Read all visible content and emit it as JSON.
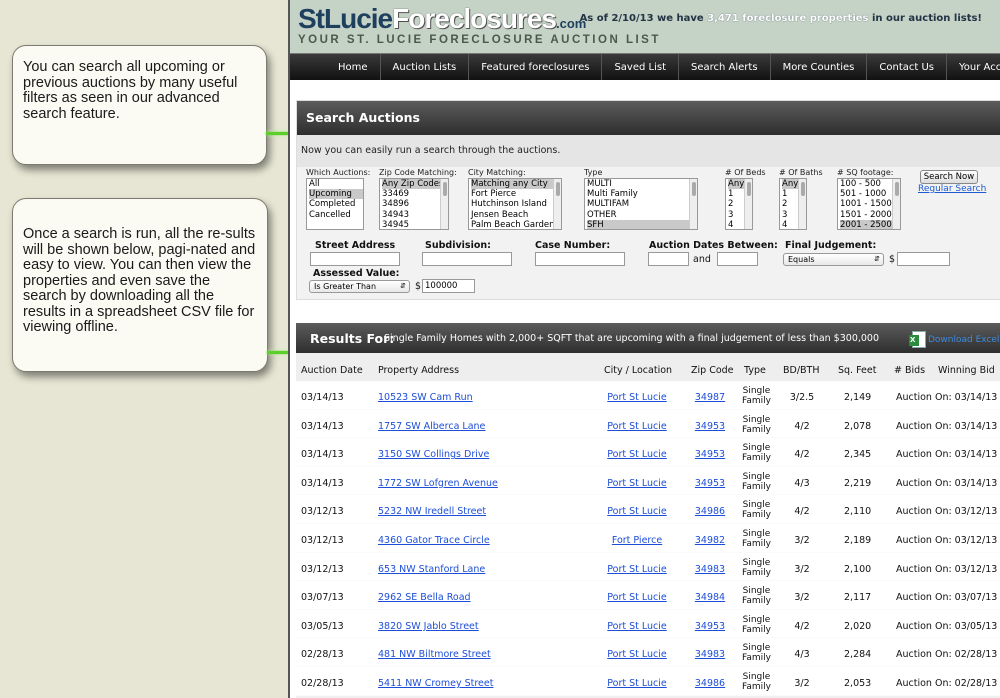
{
  "callouts": [
    {
      "text": "You can search all upcoming or previous auctions by many useful filters as seen in our advanced search feature."
    },
    {
      "text": "Once a search is run, all the re-sults will be shown below, pagi-nated and easy to view.  You can then view the properties and even save the search by downloading all the results in a spreadsheet CSV file for viewing offline."
    }
  ],
  "header": {
    "logo_part1": "StLucie",
    "logo_part2": "Foreclosures",
    "logo_part3": ".com",
    "tagline": "YOUR ST. LUCIE FORECLOSURE AUCTION LIST",
    "as_of_prefix": "As of 2/10/13 we have",
    "as_of_count": "3,471 foreclosure properties",
    "as_of_suffix": "in our auction lists!"
  },
  "nav": [
    "Home",
    "Auction Lists",
    "Featured foreclosures",
    "Saved List",
    "Search Alerts",
    "More Counties",
    "Contact Us",
    "Your Account"
  ],
  "search": {
    "title": "Search Auctions",
    "intro": "Now you can easily run a search through the auctions.",
    "which_label": "Which Auctions:",
    "which_options": [
      "All",
      "Upcoming",
      "Completed",
      "Cancelled"
    ],
    "zip_label": "Zip Code Matching:",
    "zip_options": [
      "Any Zip Codes",
      "33469",
      "34896",
      "34943",
      "34945"
    ],
    "city_label": "City Matching:",
    "city_options": [
      "Matching any City",
      "Fort Pierce",
      "Hutchinson Island",
      "Jensen Beach",
      "Palm Beach Gardens"
    ],
    "type_label": "Type",
    "type_options": [
      "MULTI",
      "Multi Family",
      "MULTIFAM",
      "OTHER",
      "SFH"
    ],
    "beds_label": "# Of Beds",
    "beds_options": [
      "Any",
      "1",
      "2",
      "3",
      "4"
    ],
    "baths_label": "# Of Baths",
    "baths_options": [
      "Any",
      "1",
      "2",
      "3",
      "4"
    ],
    "sqft_label": "# SQ footage:",
    "sqft_options": [
      "100 - 500",
      "501 - 1000",
      "1001 - 1500",
      "1501 - 2000",
      "2001 - 2500"
    ],
    "search_now": "Search Now",
    "regular_search": "Regular Search",
    "street_label": "Street Address",
    "subdivision_label": "Subdivision:",
    "case_label": "Case Number:",
    "dates_label": "Auction Dates Between:",
    "and_label": "and",
    "judgement_label": "Final Judgement:",
    "judgement_op": "Equals",
    "dollar": "$",
    "assessed_label": "Assessed Value:",
    "assessed_op": "Is Greater Than",
    "assessed_value": "100000"
  },
  "results": {
    "title": "Results For:",
    "description": "Single Family Homes with 2,000+ SQFT  that are upcoming with a final judgement of less than $300,000",
    "download": "Download Excel",
    "columns": [
      "Auction Date",
      "Property Address",
      "City / Location",
      "Zip Code",
      "Type",
      "BD/BTH",
      "Sq. Feet",
      "# Bids",
      "Winning Bid"
    ],
    "rows": [
      {
        "date": "03/14/13",
        "address": "10523 SW Cam Run",
        "city": "Port St Lucie",
        "zip": "34987",
        "type1": "Single",
        "type2": "Family",
        "bdbth": "3/2.5",
        "sqft": "2,149",
        "bids": "Auction On: 03/14/13"
      },
      {
        "date": "03/14/13",
        "address": "1757 SW Alberca Lane",
        "city": "Port St Lucie",
        "zip": "34953",
        "type1": "Single",
        "type2": "Family",
        "bdbth": "4/2",
        "sqft": "2,078",
        "bids": "Auction On: 03/14/13"
      },
      {
        "date": "03/14/13",
        "address": "3150 SW Collings Drive",
        "city": "Port St Lucie",
        "zip": "34953",
        "type1": "Single",
        "type2": "Family",
        "bdbth": "4/2",
        "sqft": "2,345",
        "bids": "Auction On: 03/14/13"
      },
      {
        "date": "03/14/13",
        "address": "1772 SW Lofgren Avenue",
        "city": "Port St Lucie",
        "zip": "34953",
        "type1": "Single",
        "type2": "Family",
        "bdbth": "4/3",
        "sqft": "2,219",
        "bids": "Auction On: 03/14/13"
      },
      {
        "date": "03/12/13",
        "address": "5232 NW Iredell Street",
        "city": "Port St Lucie",
        "zip": "34986",
        "type1": "Single",
        "type2": "Family",
        "bdbth": "4/2",
        "sqft": "2,110",
        "bids": "Auction On: 03/12/13"
      },
      {
        "date": "03/12/13",
        "address": "4360 Gator Trace Circle",
        "city": "Fort Pierce",
        "zip": "34982",
        "type1": "Single",
        "type2": "Family",
        "bdbth": "3/2",
        "sqft": "2,189",
        "bids": "Auction On: 03/12/13"
      },
      {
        "date": "03/12/13",
        "address": "653 NW Stanford Lane",
        "city": "Port St Lucie",
        "zip": "34983",
        "type1": "Single",
        "type2": "Family",
        "bdbth": "3/2",
        "sqft": "2,100",
        "bids": "Auction On: 03/12/13"
      },
      {
        "date": "03/07/13",
        "address": "2962 SE Bella Road",
        "city": "Port St Lucie",
        "zip": "34984",
        "type1": "Single",
        "type2": "Family",
        "bdbth": "3/2",
        "sqft": "2,117",
        "bids": "Auction On: 03/07/13"
      },
      {
        "date": "03/05/13",
        "address": "3820 SW Jablo Street",
        "city": "Port St Lucie",
        "zip": "34953",
        "type1": "Single",
        "type2": "Family",
        "bdbth": "4/2",
        "sqft": "2,020",
        "bids": "Auction On: 03/05/13"
      },
      {
        "date": "02/28/13",
        "address": "481 NW Biltmore Street",
        "city": "Port St Lucie",
        "zip": "34983",
        "type1": "Single",
        "type2": "Family",
        "bdbth": "4/3",
        "sqft": "2,284",
        "bids": "Auction On: 02/28/13"
      },
      {
        "date": "02/28/13",
        "address": "5411 NW Cromey Street",
        "city": "Port St Lucie",
        "zip": "34986",
        "type1": "Single",
        "type2": "Family",
        "bdbth": "3/2",
        "sqft": "2,053",
        "bids": "Auction On: 02/28/13"
      }
    ]
  }
}
